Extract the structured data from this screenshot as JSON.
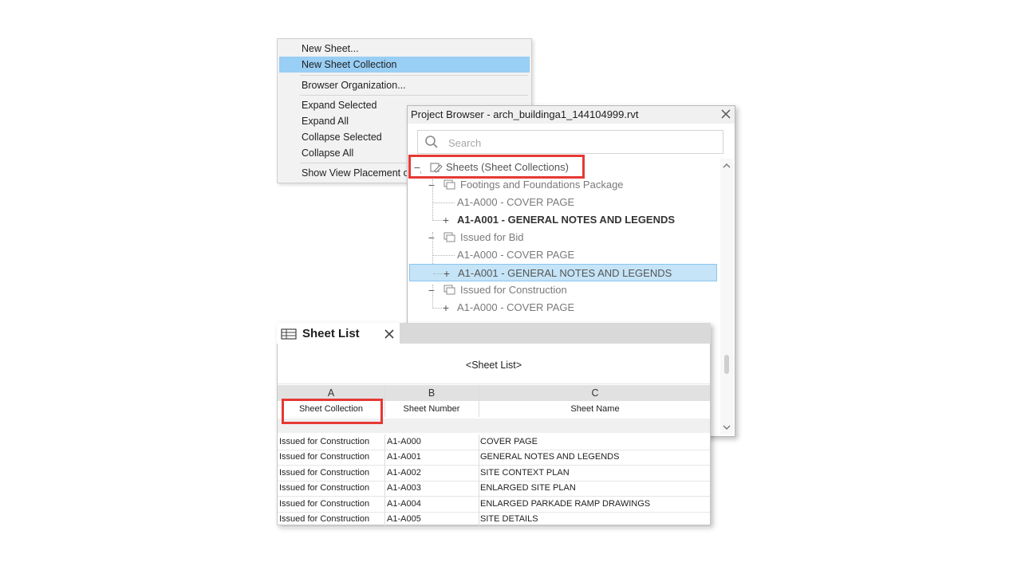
{
  "context_menu": {
    "items": [
      {
        "label": "New Sheet..."
      },
      {
        "label": "New Sheet Collection"
      },
      {
        "label": "Browser Organization..."
      },
      {
        "label": "Expand Selected"
      },
      {
        "label": "Expand All"
      },
      {
        "label": "Collapse Selected"
      },
      {
        "label": "Collapse All"
      },
      {
        "label": "Show View Placement on Sheet Status Icons"
      }
    ],
    "highlighted_item": "New Sheet Collection",
    "checked_item": "Show View Placement on Sheet Status Icons"
  },
  "project_browser": {
    "title": "Project Browser - arch_buildinga1_144104999.rvt",
    "search_placeholder": "Search",
    "tree": {
      "root": {
        "label": "Sheets (Sheet Collections)",
        "toggle": "−"
      },
      "groups": [
        {
          "label": "Footings and Foundations Package",
          "toggle": "−",
          "children": [
            {
              "label": "A1-A000 - COVER PAGE",
              "toggle": ""
            },
            {
              "label": "A1-A001 - GENERAL NOTES AND LEGENDS",
              "toggle": "+"
            }
          ]
        },
        {
          "label": "Issued for Bid",
          "toggle": "−",
          "children": [
            {
              "label": "A1-A000 - COVER PAGE",
              "toggle": ""
            },
            {
              "label": "A1-A001 - GENERAL NOTES AND LEGENDS",
              "toggle": "+"
            }
          ]
        },
        {
          "label": "Issued for Construction",
          "toggle": "−",
          "children": [
            {
              "label": "A1-A000 - COVER PAGE",
              "toggle": "+"
            }
          ]
        }
      ]
    }
  },
  "sheet_list": {
    "tab_label": "Sheet List",
    "caption": "<Sheet List>",
    "column_letters": [
      "A",
      "B",
      "C"
    ],
    "column_headers": [
      "Sheet Collection",
      "Sheet Number",
      "Sheet Name"
    ],
    "rows": [
      [
        "Issued for Construction",
        "A1-A000",
        "COVER PAGE"
      ],
      [
        "Issued for Construction",
        "A1-A001",
        "GENERAL NOTES AND LEGENDS"
      ],
      [
        "Issued for Construction",
        "A1-A002",
        "SITE CONTEXT PLAN"
      ],
      [
        "Issued for Construction",
        "A1-A003",
        "ENLARGED SITE PLAN"
      ],
      [
        "Issued for Construction",
        "A1-A004",
        "ENLARGED PARKADE RAMP DRAWINGS"
      ],
      [
        "Issued for Construction",
        "A1-A005",
        "SITE DETAILS"
      ]
    ]
  },
  "colors": {
    "highlight": "#99cef5",
    "selection": "#c5e4f7",
    "callout": "#e53935",
    "checkmark": "#1a73c9"
  }
}
